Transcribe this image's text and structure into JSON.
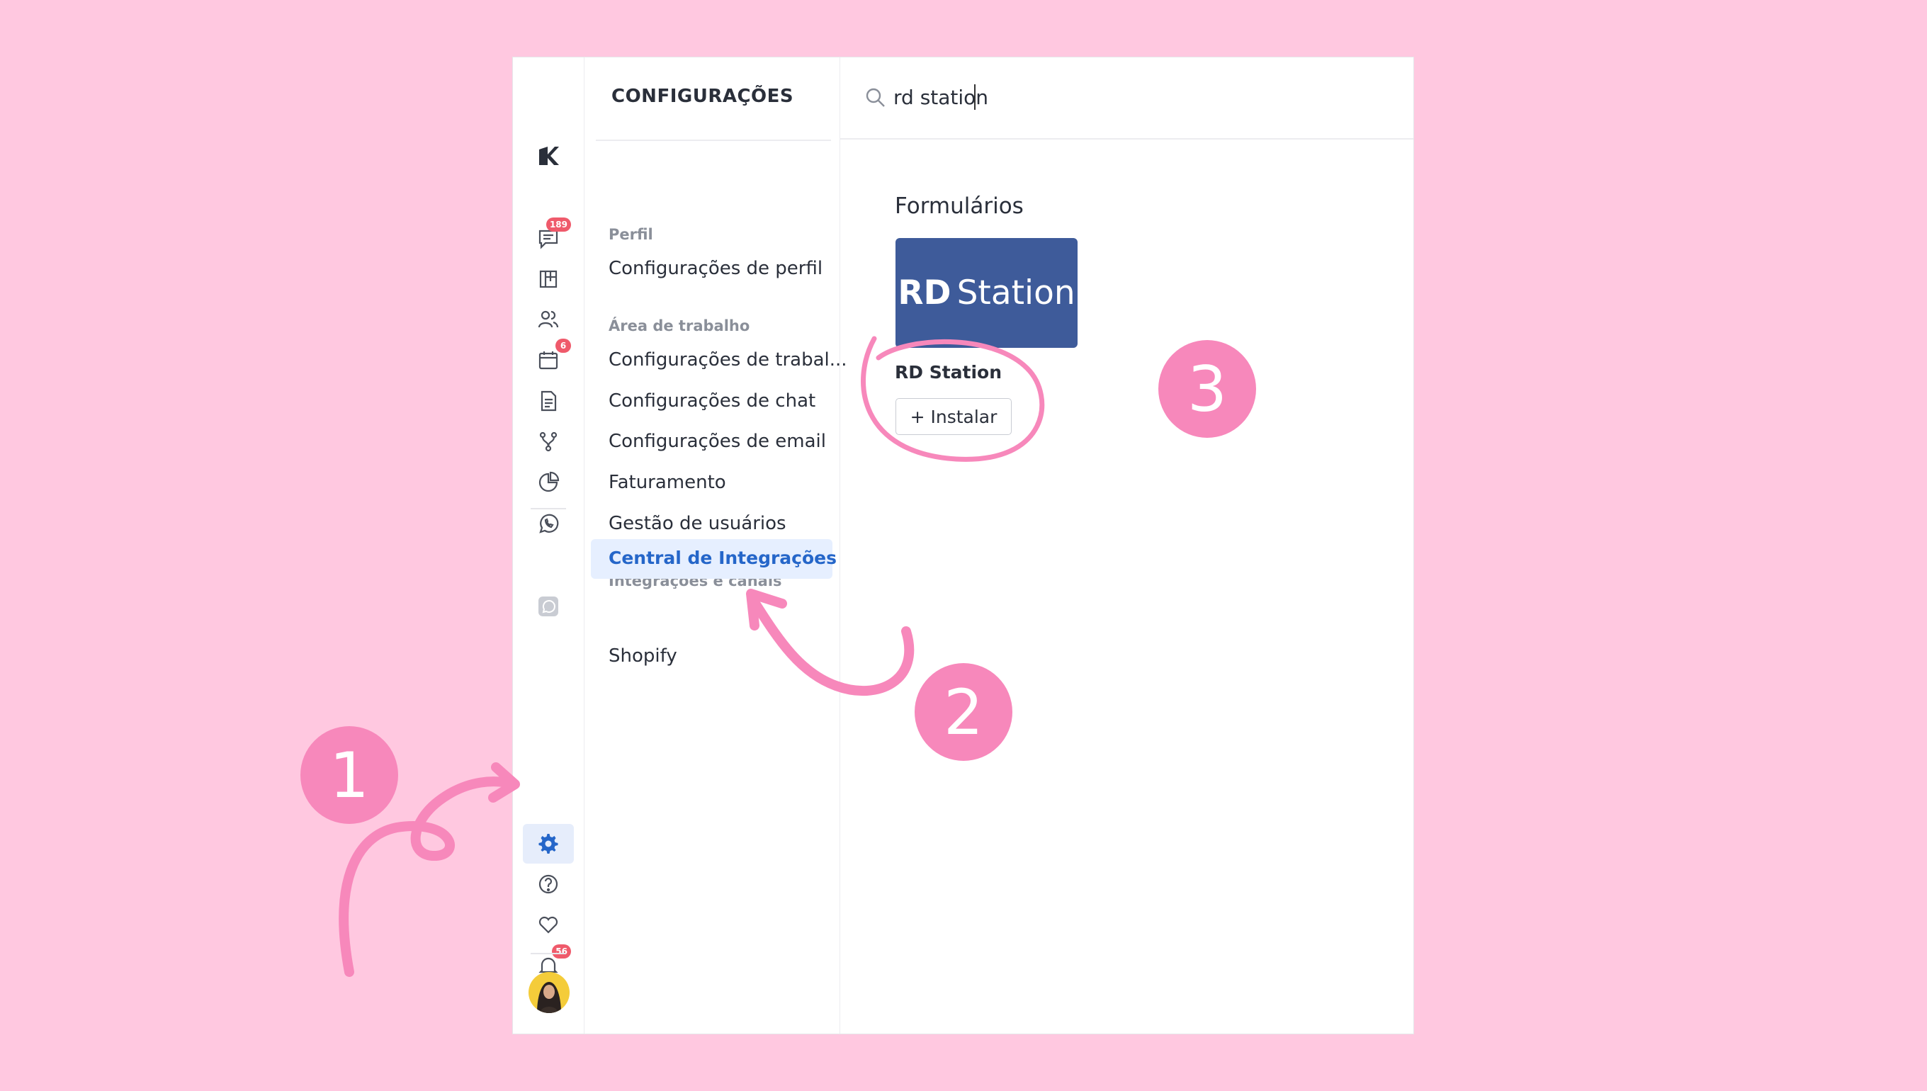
{
  "rail": {
    "badges": {
      "chat": "189",
      "calendar": "6",
      "notifications": "56"
    }
  },
  "menu": {
    "title": "CONFIGURAÇÕES",
    "sections": {
      "perfil": "Perfil",
      "area_trabalho": "Área de trabalho",
      "integracoes": "Integrações e canais"
    },
    "items": {
      "config_perfil": "Configurações de perfil",
      "config_trabalho": "Configurações de trabal...",
      "config_chat": "Configurações de chat",
      "config_email": "Configurações de email",
      "faturamento": "Faturamento",
      "gestao_usuarios": "Gestão de usuários",
      "central_integracoes": "Central de Integrações",
      "shopify": "Shopify"
    }
  },
  "main": {
    "search_value": "rd station",
    "section_title": "Formulários",
    "card": {
      "logo_bold": "RD",
      "logo_rest": "Station",
      "name": "RD Station",
      "install_label": "+ Instalar"
    }
  },
  "annotations": {
    "step1": "1",
    "step2": "2",
    "step3": "3"
  },
  "colors": {
    "background": "#ffc8e0",
    "accent": "#2566c9",
    "annotation": "#f788bb",
    "rd_station": "#3e5b9a"
  }
}
